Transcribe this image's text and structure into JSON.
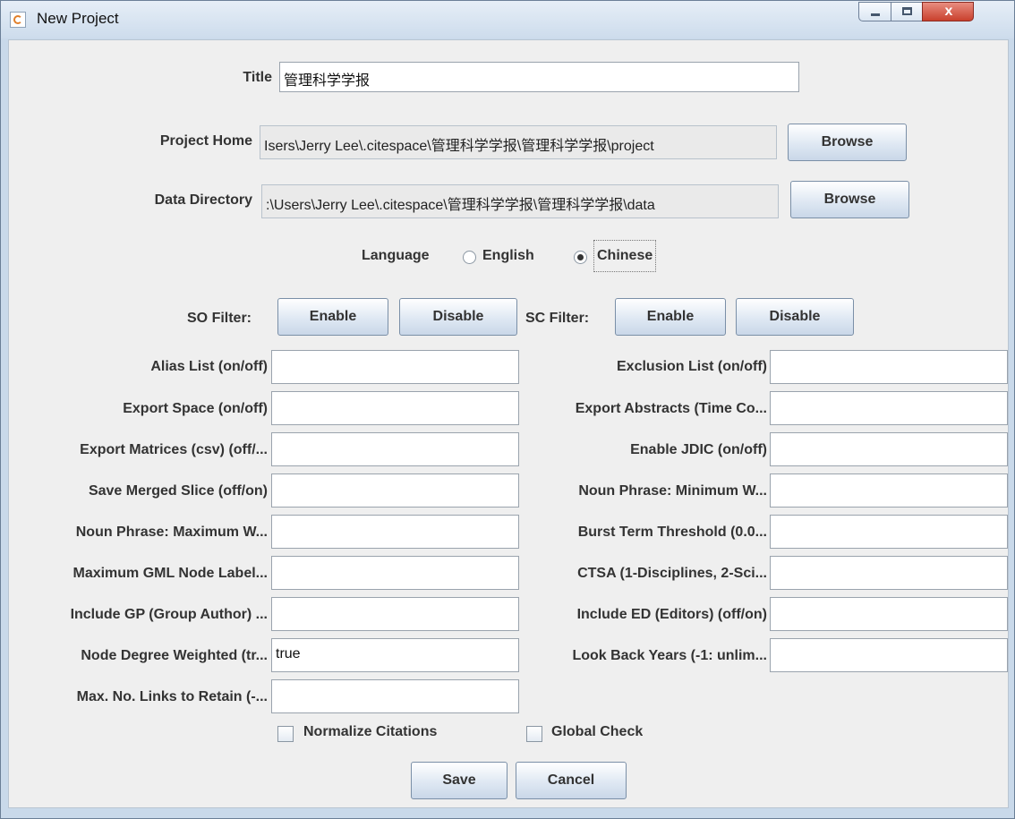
{
  "window": {
    "title": "New Project",
    "close_glyph": "x",
    "icons": [
      "java-app-icon",
      "minimize-icon",
      "maximize-icon",
      "close-icon"
    ]
  },
  "form": {
    "title_label": "Title",
    "title_value": "管理科学学报",
    "project_home_label": "Project Home",
    "project_home_value": "Isers\\Jerry Lee\\.citespace\\管理科学学报\\管理科学学报\\project",
    "data_directory_label": "Data Directory",
    "data_directory_value": ":\\Users\\Jerry Lee\\.citespace\\管理科学学报\\管理科学学报\\data",
    "browse_label": "Browse",
    "language_label": "Language",
    "language_options": [
      "English",
      "Chinese"
    ],
    "language_selected": "Chinese"
  },
  "filters": {
    "so_label": "SO Filter:",
    "sc_label": "SC Filter:",
    "enable_label": "Enable",
    "disable_label": "Disable"
  },
  "params_left": [
    {
      "label": "Alias List (on/off)",
      "value": ""
    },
    {
      "label": "Export Space (on/off)",
      "value": ""
    },
    {
      "label": "Export Matrices (csv) (off/...",
      "value": ""
    },
    {
      "label": "Save Merged Slice (off/on)",
      "value": ""
    },
    {
      "label": "Noun Phrase: Maximum W...",
      "value": ""
    },
    {
      "label": "Maximum GML Node Label...",
      "value": ""
    },
    {
      "label": "Include GP (Group Author) ...",
      "value": ""
    },
    {
      "label": "Node Degree Weighted (tr...",
      "value": "true"
    },
    {
      "label": "Max. No. Links to Retain (-...",
      "value": ""
    }
  ],
  "params_right": [
    {
      "label": "Exclusion List (on/off)",
      "value": ""
    },
    {
      "label": "Export Abstracts (Time Co...",
      "value": ""
    },
    {
      "label": "Enable JDIC (on/off)",
      "value": ""
    },
    {
      "label": "Noun Phrase: Minimum W...",
      "value": ""
    },
    {
      "label": "Burst Term Threshold (0.0...",
      "value": ""
    },
    {
      "label": "CTSA (1-Disciplines, 2-Sci...",
      "value": ""
    },
    {
      "label": "Include ED (Editors) (off/on)",
      "value": ""
    },
    {
      "label": "Look Back Years (-1: unlim...",
      "value": ""
    }
  ],
  "checkboxes": [
    {
      "label": "Normalize Citations",
      "checked": false
    },
    {
      "label": "Global Check",
      "checked": false
    }
  ],
  "actions": {
    "save_label": "Save",
    "cancel_label": "Cancel"
  }
}
